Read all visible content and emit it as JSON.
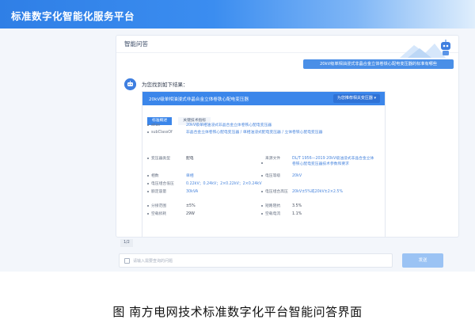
{
  "app": {
    "title": "标准数字化智能化服务平台"
  },
  "panel": {
    "title": "智能问答"
  },
  "chat": {
    "question": "20kV级单相油浸式非晶合金立体卷铁心配电变压器的标准有哪些",
    "answer_intro": "为您找到如下结果：",
    "result_title": "20kV级单相油浸式非晶合金立体卷铁心配电变压器",
    "result_chip": "为您推荐相关变压器 ▾",
    "tabs": [
      {
        "label": "标准概述",
        "active": true
      },
      {
        "label": "关键技术指标",
        "active": false
      }
    ],
    "rows": [
      {
        "label": "alias",
        "value": "20kV级单相油浸式非晶合金立体卷铁心配电变压器"
      },
      {
        "label": "subClassOf",
        "value": "非晶合金立体卷铁心配电变压器 / 单相油浸式配电变压器 / 立体卷铁心配电变压器"
      },
      {
        "label": "变压器类型",
        "value": "配电"
      },
      {
        "label": "来源文件",
        "value": "DL/T 1956—2019 20kV级油浸式非晶合金立体卷铁心配电变压器技术参数和要求"
      },
      {
        "label": "相数",
        "value": "单相"
      },
      {
        "label": "电压等级",
        "value": "20kV"
      },
      {
        "label": "电压组合低压",
        "value": "0.22kV；0.24kV；2×0.22kV；2×0.24kV"
      },
      {
        "label": "额定容量",
        "value": "30kVA"
      },
      {
        "label": "电压组合高压",
        "value": "20kV±5%或20kV±2×2.5%"
      },
      {
        "label": "短路阻抗",
        "value": "3.5%"
      },
      {
        "label": "分接范围",
        "value": "±5%"
      },
      {
        "label": "空载电流",
        "value": "1.1%"
      },
      {
        "label": "空载损耗",
        "value": "29W"
      }
    ]
  },
  "pager": {
    "label": "1/2"
  },
  "input": {
    "placeholder": "请输入需要查询的问题"
  },
  "send": {
    "label": "发送"
  },
  "caption": "图 南方电网技术标准数字化平台智能问答界面",
  "colors": {
    "accent": "#3b86ea",
    "topbar": "#2f7fe6",
    "send_disabled": "#9bc3f4"
  },
  "icons": {
    "bot": "robot-icon",
    "input": "chat-icon"
  }
}
